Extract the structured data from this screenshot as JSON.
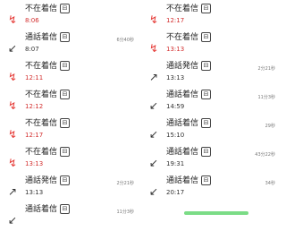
{
  "call_log": {
    "left": [
      {
        "type": "missed",
        "title": "不在着信",
        "time": "8:06",
        "duration": ""
      },
      {
        "type": "incoming",
        "title": "通話着信",
        "time": "8:07",
        "duration": "6分40秒"
      },
      {
        "type": "missed",
        "title": "不在着信",
        "time": "12:11",
        "duration": ""
      },
      {
        "type": "missed",
        "title": "不在着信",
        "time": "12:12",
        "duration": ""
      },
      {
        "type": "missed",
        "title": "不在着信",
        "time": "12:17",
        "duration": ""
      },
      {
        "type": "missed",
        "title": "不在着信",
        "time": "13:13",
        "duration": ""
      },
      {
        "type": "outgoing",
        "title": "通話発信",
        "time": "13:13",
        "duration": "2分21秒"
      },
      {
        "type": "incoming",
        "title": "通話着信",
        "time": "",
        "duration": "11分3秒"
      }
    ],
    "right": [
      {
        "type": "missed",
        "title": "不在着信",
        "time": "12:17",
        "duration": ""
      },
      {
        "type": "missed",
        "title": "不在着信",
        "time": "13:13",
        "duration": ""
      },
      {
        "type": "outgoing",
        "title": "通話発信",
        "time": "13:13",
        "duration": "2分21秒"
      },
      {
        "type": "incoming",
        "title": "通話着信",
        "time": "14:59",
        "duration": "11分3秒"
      },
      {
        "type": "incoming",
        "title": "通話着信",
        "time": "15:10",
        "duration": "29秒"
      },
      {
        "type": "incoming",
        "title": "通話着信",
        "time": "19:31",
        "duration": "43分22秒"
      },
      {
        "type": "incoming",
        "title": "通話着信",
        "time": "20:17",
        "duration": "34秒"
      }
    ]
  },
  "sim_badge": "⊟",
  "icons": {
    "missed": "↯",
    "incoming": "↙",
    "outgoing": "↗"
  },
  "colors": {
    "missed": "#e53935",
    "time_red": "#d32f2f",
    "time_dark": "#333333",
    "accent_bar": "#7bdc86"
  }
}
